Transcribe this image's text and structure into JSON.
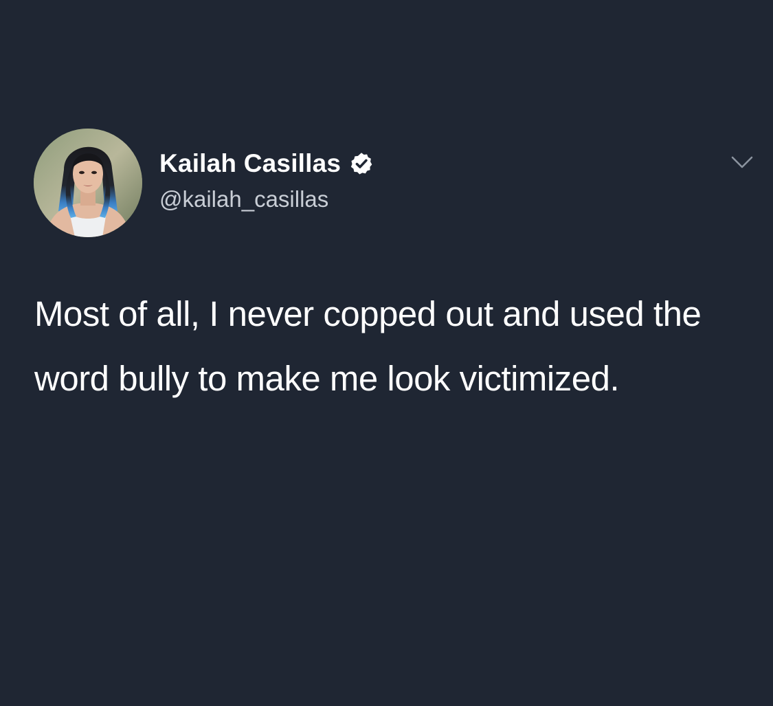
{
  "tweet": {
    "author": {
      "display_name": "Kailah Casillas",
      "handle": "@kailah_casillas",
      "verified": true,
      "avatar_icon": "profile-photo"
    },
    "text": "Most of all, I never copped out and used the word bully to make me look victimized.",
    "menu_icon": "chevron-down-icon"
  },
  "colors": {
    "background": "#1f2633",
    "text_primary": "#ffffff",
    "text_secondary": "#c9ced6",
    "verified_badge": "#ffffff"
  }
}
